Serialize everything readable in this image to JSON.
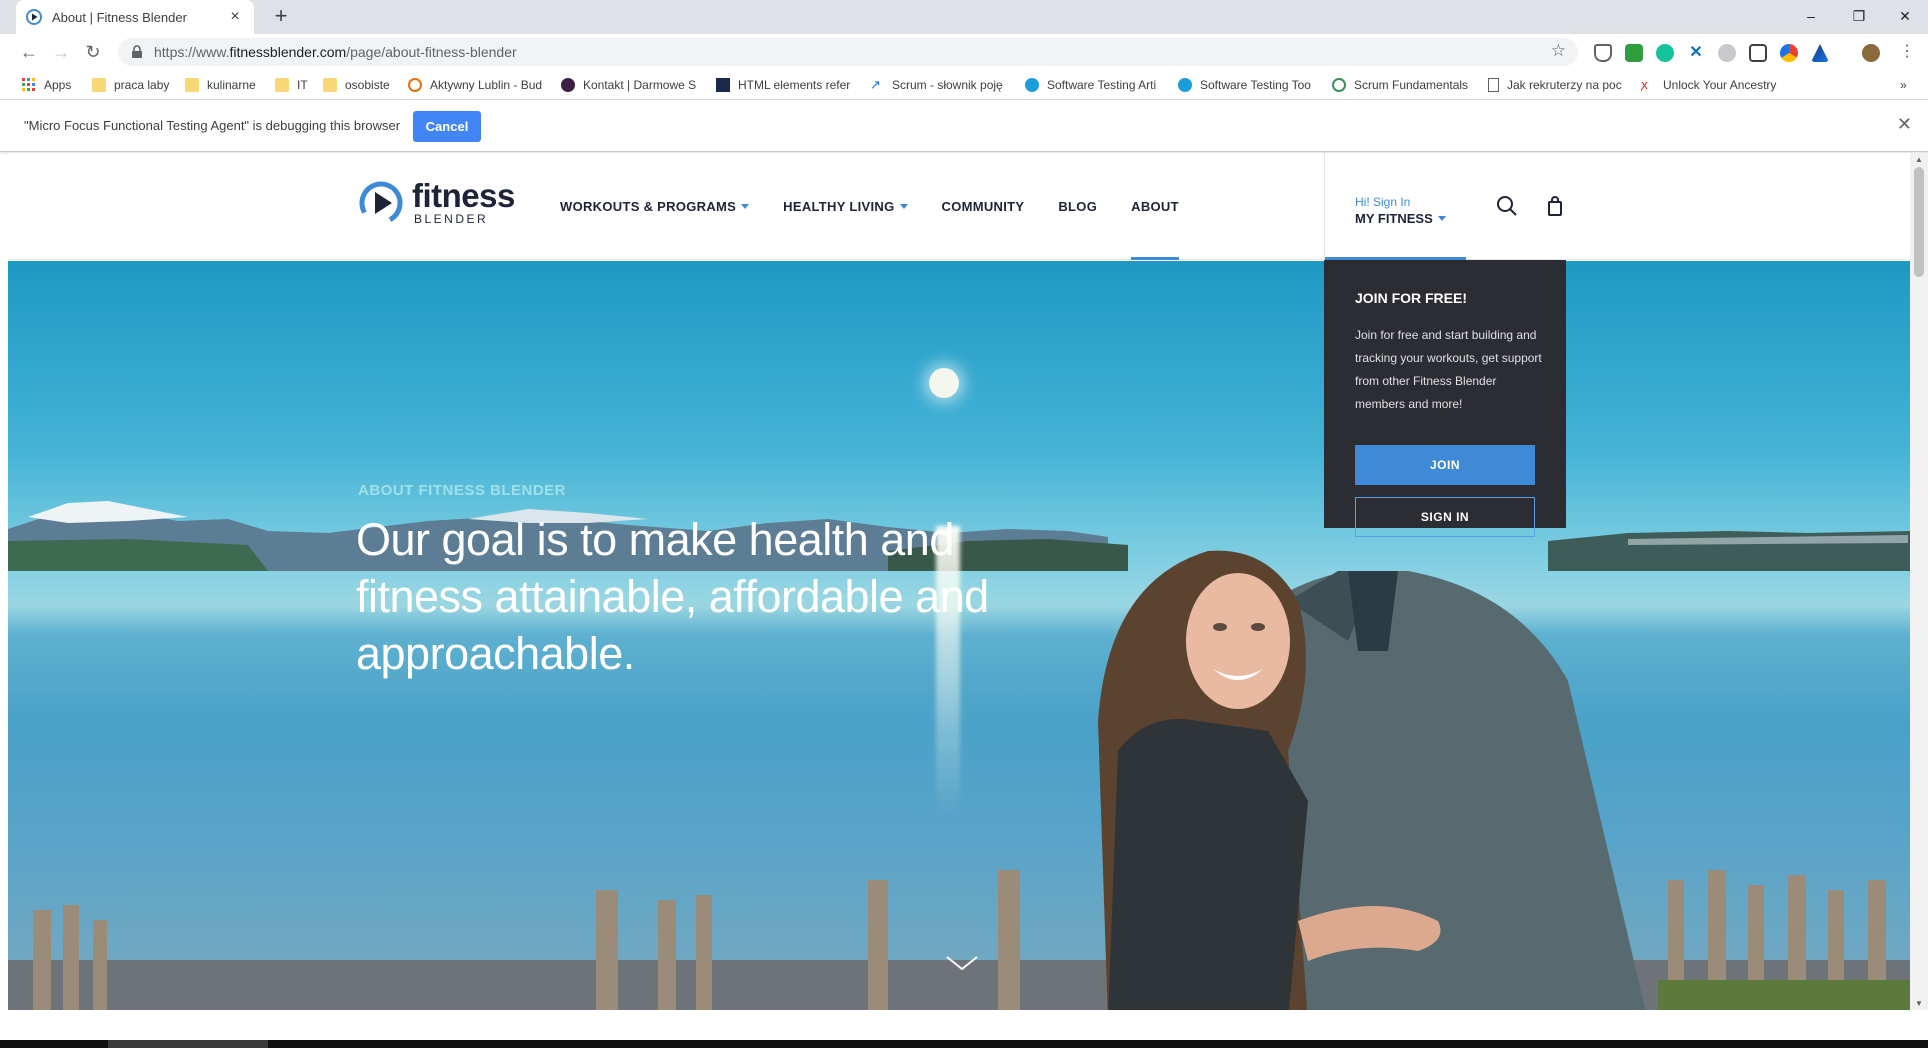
{
  "browser": {
    "tab_title": "About | Fitness Blender",
    "tab_close": "×",
    "new_tab": "+",
    "window_minimize": "–",
    "window_restore": "❐",
    "window_close": "✕",
    "url_prefix": "https://www.",
    "url_domain": "fitnessblender.com",
    "url_path": "/page/about-fitness-blender",
    "bookmarks": [
      {
        "label": "Apps",
        "icon": "apps-grid-icon"
      },
      {
        "label": "praca laby",
        "icon": "folder-icon"
      },
      {
        "label": "kulinarne",
        "icon": "folder-icon"
      },
      {
        "label": "IT",
        "icon": "folder-icon"
      },
      {
        "label": "osobiste",
        "icon": "folder-icon"
      },
      {
        "label": "Aktywny Lublin - Bud",
        "icon": "site-icon"
      },
      {
        "label": "Kontakt | Darmowe S",
        "icon": "site-icon"
      },
      {
        "label": "HTML elements refer",
        "icon": "site-icon"
      },
      {
        "label": "Scrum - słownik poję",
        "icon": "site-icon"
      },
      {
        "label": "Software Testing Arti",
        "icon": "site-icon"
      },
      {
        "label": "Software Testing Too",
        "icon": "site-icon"
      },
      {
        "label": "Scrum Fundamentals",
        "icon": "site-icon"
      },
      {
        "label": "Jak rekruterzy na poc",
        "icon": "page-icon"
      },
      {
        "label": "Unlock Your Ancestry",
        "icon": "site-icon"
      }
    ],
    "bookmarks_more": "»"
  },
  "debug_bar": {
    "message": "\"Micro Focus Functional Testing Agent\" is debugging this browser",
    "cancel_label": "Cancel",
    "close": "✕"
  },
  "site": {
    "logo_word": "fitness",
    "logo_sub": "BLENDER",
    "nav": [
      {
        "label": "WORKOUTS & PROGRAMS",
        "has_caret": true
      },
      {
        "label": "HEALTHY LIVING",
        "has_caret": true
      },
      {
        "label": "COMMUNITY",
        "has_caret": false
      },
      {
        "label": "BLOG",
        "has_caret": false
      },
      {
        "label": "ABOUT",
        "has_caret": false,
        "active": true
      }
    ],
    "account_greeting": "Hi! Sign In",
    "account_label": "MY FITNESS",
    "accent_color": "#3f8ad6"
  },
  "hero": {
    "eyebrow": "ABOUT FITNESS BLENDER",
    "headline": "Our goal is to make health and fitness attainable, affordable and approachable."
  },
  "dropdown": {
    "title": "JOIN FOR FREE!",
    "description": "Join for free and start building and tracking your workouts, get support from other Fitness Blender members and more!",
    "join_label": "JOIN",
    "signin_label": "SIGN IN"
  }
}
